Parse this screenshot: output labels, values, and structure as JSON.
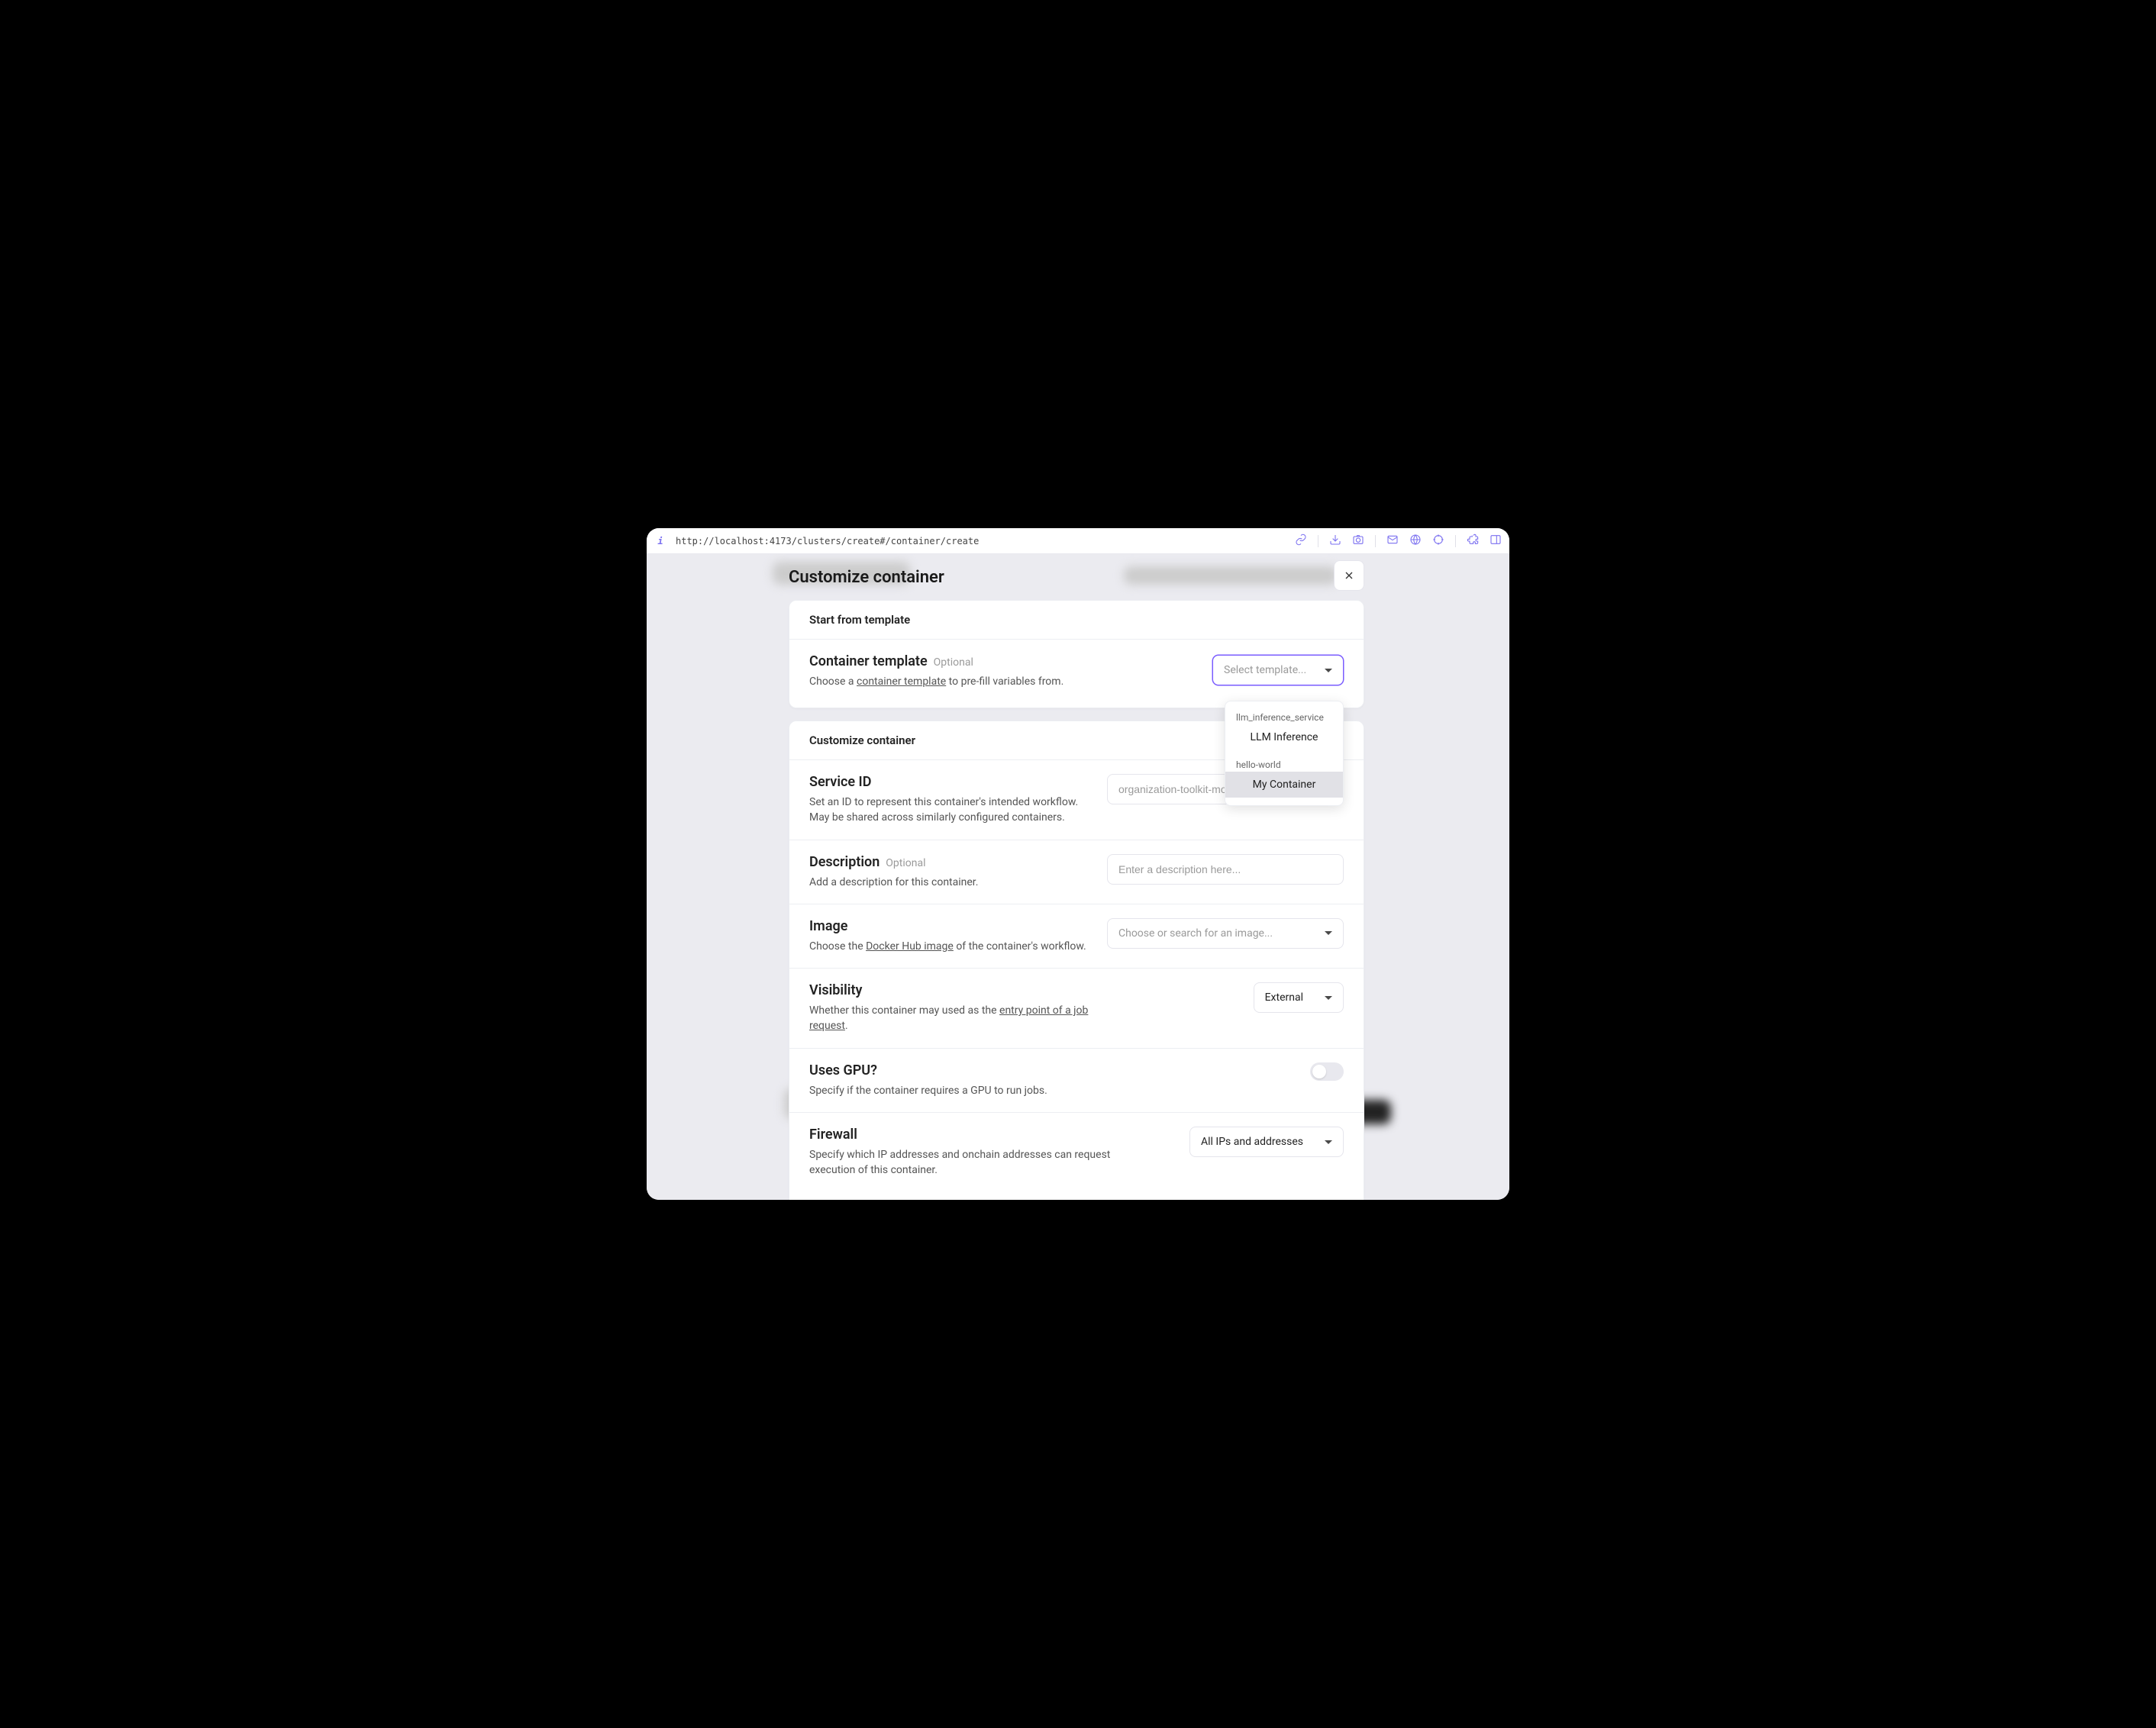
{
  "url": "http://localhost:4173/clusters/create#/container/create",
  "modal_title": "Customize container",
  "card1": {
    "head": "Start from template",
    "template": {
      "label": "Container template",
      "tag": "Optional",
      "help_pre": "Choose a ",
      "help_link": "container template",
      "help_post": " to pre-fill variables from.",
      "placeholder": "Select template...",
      "options": [
        {
          "group": "llm_inference_service",
          "label": "LLM Inference",
          "highlighted": false
        },
        {
          "group": "hello-world",
          "label": "My Container",
          "highlighted": true
        }
      ]
    }
  },
  "card2": {
    "head": "Customize container",
    "service": {
      "label": "Service ID",
      "help": "Set an ID to represent this container's intended workflow. May be shared across similarly configured containers.",
      "placeholder": "organization-toolkit-model-version"
    },
    "description": {
      "label": "Description",
      "tag": "Optional",
      "help": "Add a description for this container.",
      "placeholder": "Enter a description here..."
    },
    "image": {
      "label": "Image",
      "help_pre": "Choose the ",
      "help_link": "Docker Hub image",
      "help_post": " of the container's workflow.",
      "placeholder": "Choose or search for an image..."
    },
    "visibility": {
      "label": "Visibility",
      "help_pre": "Whether this container may used as the ",
      "help_link": "entry point of a job request",
      "help_post": ".",
      "value": "External"
    },
    "gpu": {
      "label": "Uses GPU?",
      "help": "Specify if the container requires a GPU to run jobs."
    },
    "firewall": {
      "label": "Firewall",
      "help": "Specify which IP addresses and onchain addresses can request execution of this container.",
      "value": "All IPs and addresses"
    }
  }
}
